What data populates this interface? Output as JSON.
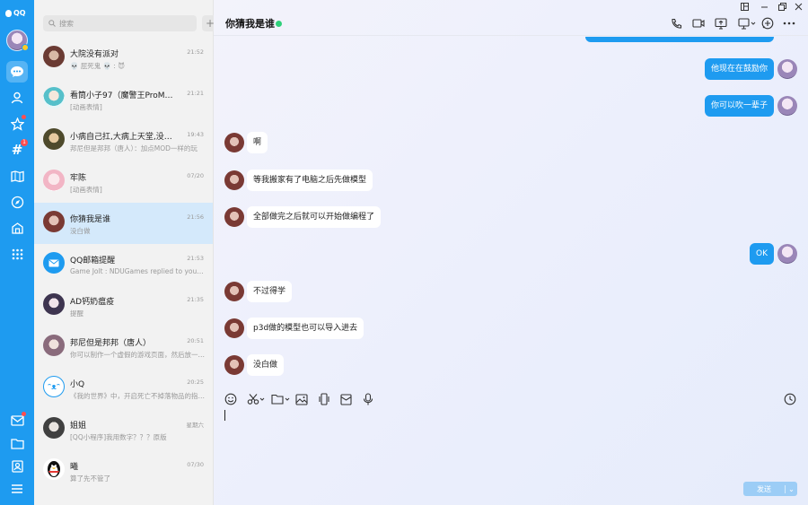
{
  "app": {
    "logo_text": "QQ",
    "colors": {
      "brand": "#1e9bf0",
      "online": "#2fd07a",
      "badge": "#ff4d4f"
    }
  },
  "rail": {
    "nav": [
      {
        "name": "message-icon",
        "glyph": "💬",
        "active": true
      },
      {
        "name": "contacts-icon",
        "glyph": "👤"
      },
      {
        "name": "favorites-icon",
        "glyph": "☆",
        "badge_dot": true
      },
      {
        "name": "channel-icon",
        "glyph": "#",
        "badge": "1"
      },
      {
        "name": "game-icon",
        "glyph": "🗺"
      },
      {
        "name": "explore-icon",
        "glyph": "✈"
      },
      {
        "name": "apps-icon",
        "glyph": "⌂"
      },
      {
        "name": "more-apps-icon",
        "glyph": "⠿"
      }
    ],
    "bottom": [
      {
        "name": "mail-icon",
        "glyph": "✉",
        "badge_dot": true
      },
      {
        "name": "folder-icon",
        "glyph": "🗀"
      },
      {
        "name": "id-card-icon",
        "glyph": "▣"
      },
      {
        "name": "menu-icon",
        "glyph": "≡"
      }
    ]
  },
  "search": {
    "placeholder": "搜索",
    "plus": "+"
  },
  "conversations": [
    {
      "name": "大院没有派对",
      "time": "21:52",
      "preview": "💀 屁死鬼 💀 : 😈"
    },
    {
      "name": "看筒小子97（魔警王ProMax…",
      "time": "21:21",
      "preview": "[动画表情]"
    },
    {
      "name": "小病自己扛,大病上天堂,没病…",
      "time": "19:43",
      "preview": "邦尼但是邦邦（唐人）：加点MOD一样的玩"
    },
    {
      "name": "牢陈",
      "time": "07/20",
      "preview": "[动画表情]"
    },
    {
      "name": "你猜我是谁",
      "time": "21:56",
      "preview": "没白做",
      "selected": true
    },
    {
      "name": "QQ邮箱提醒",
      "time": "21:53",
      "preview": "Game Jolt : NDUGames replied to your …"
    },
    {
      "name": "AD钙奶瘟疫",
      "time": "21:35",
      "preview": "提醒"
    },
    {
      "name": "邦尼但是邦邦（唐人）",
      "time": "20:51",
      "preview": "你可以制作一个虚假的游戏页面，然后放一…"
    },
    {
      "name": "小Q",
      "time": "20:25",
      "preview": "《我的世界》中，开启死亡不掉落物品的指…"
    },
    {
      "name": "姐姐",
      "time": "星期六",
      "preview": "[QQ小程序]我用数字？？？原版"
    },
    {
      "name": "曦",
      "time": "07/30",
      "preview": "算了先不管了"
    }
  ],
  "chat": {
    "title": "你猜我是谁",
    "messages": [
      {
        "dir": "out",
        "text": "他现在在鼓励你"
      },
      {
        "dir": "out",
        "text": "你可以吹一辈子"
      },
      {
        "dir": "in",
        "text": "啊"
      },
      {
        "dir": "in",
        "text": "等我搬家有了电脑之后先做模型"
      },
      {
        "dir": "in",
        "text": "全部做完之后就可以开始做编程了"
      },
      {
        "dir": "out",
        "text": "OK"
      },
      {
        "dir": "in",
        "text": "不过得学"
      },
      {
        "dir": "in",
        "text": "p3d做的模型也可以导入进去"
      },
      {
        "dir": "in",
        "text": "没白做"
      }
    ],
    "send_label": "发送"
  }
}
